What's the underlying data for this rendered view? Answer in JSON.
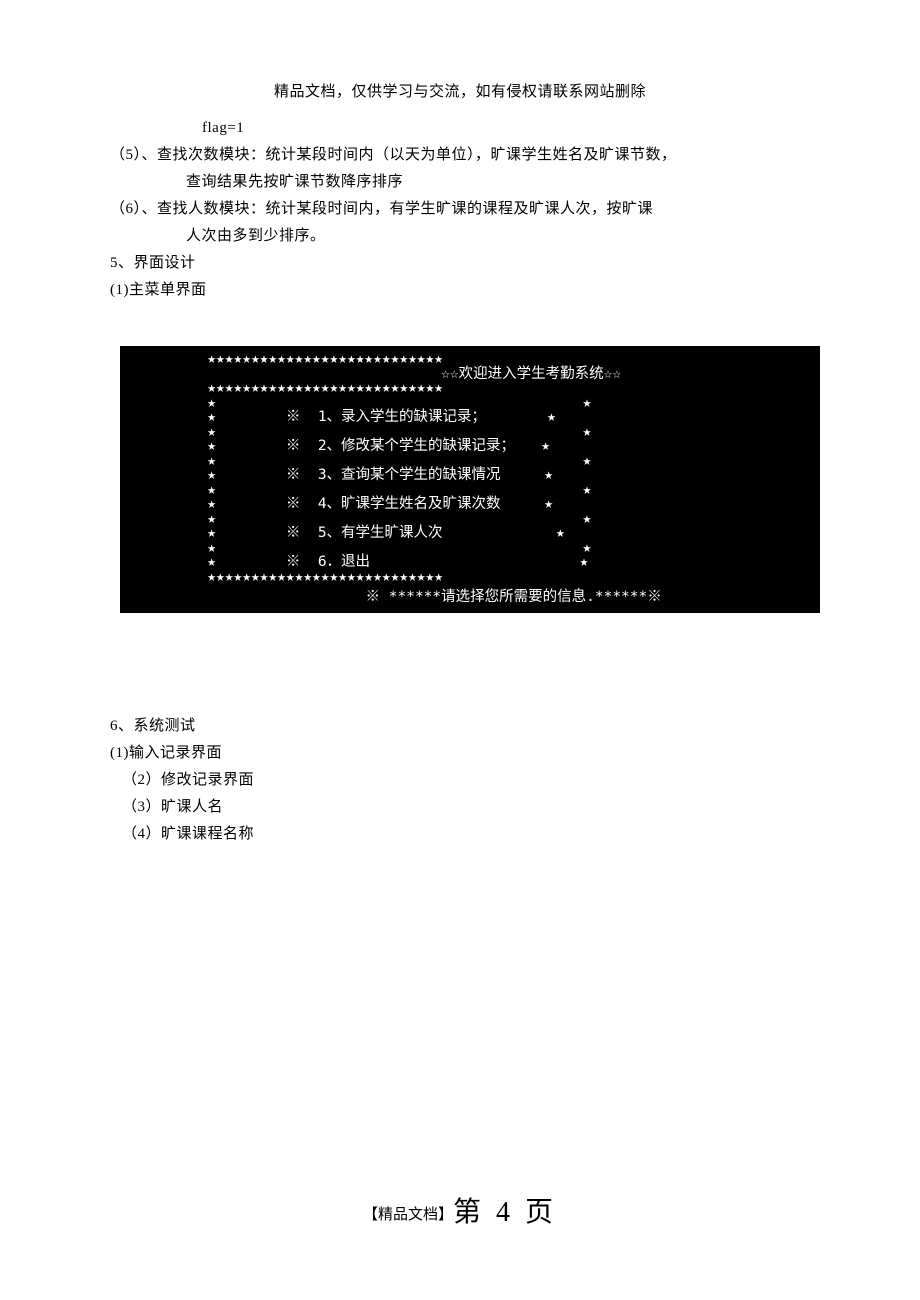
{
  "header": "精品文档，仅供学习与交流，如有侵权请联系网站删除",
  "body": {
    "flag_line": "flag=1",
    "item5": "（5）、查找次数模块：统计某段时间内（以天为单位），旷课学生姓名及旷课节数，",
    "item5b": "查询结果先按旷课节数降序排序",
    "item6": "（6）、查找人数模块：统计某段时间内，有学生旷课的课程及旷课人次，按旷课",
    "item6b": "人次由多到少排序。",
    "sec5": "5、界面设计",
    "sec5_1": "(1)主菜单界面",
    "sec6": "6、系统测试",
    "sec6_1": "(1)输入记录界面",
    "sec6_2": "（2）修改记录界面",
    "sec6_3": "（3）旷课人名",
    "sec6_4": "（4）旷课课程名称"
  },
  "console": {
    "star_row_top": "          ★★★★★★★★★★★★★★★★★★★★★★★★★★★",
    "welcome": "              ☆☆欢迎进入学生考勤系统☆☆",
    "star_row_mid": "          ★★★★★★★★★★★★★★★★★★★★★★★★★★★",
    "side_row_blank": "          ★                                          ★",
    "menu": [
      "          ★        ※  1、录入学生的缺课记录；       ★",
      "          ★                                          ★",
      "          ★        ※  2、修改某个学生的缺课记录；   ★",
      "          ★                                          ★",
      "          ★        ※  3、查询某个学生的缺课情况     ★",
      "          ★                                          ★",
      "          ★        ※  4、旷课学生姓名及旷课次数     ★",
      "          ★                                          ★",
      "          ★        ※  5、有学生旷课人次             ★",
      "          ★                                          ★",
      "          ★        ※  6．退出                        ★"
    ],
    "star_row_bot": "          ★★★★★★★★★★★★★★★★★★★★★★★★★★★",
    "prompt": "          ※ ******请选择您所需要的信息.******※"
  },
  "footer": {
    "prefix": "【精品文档】",
    "page": "第 4 页"
  }
}
